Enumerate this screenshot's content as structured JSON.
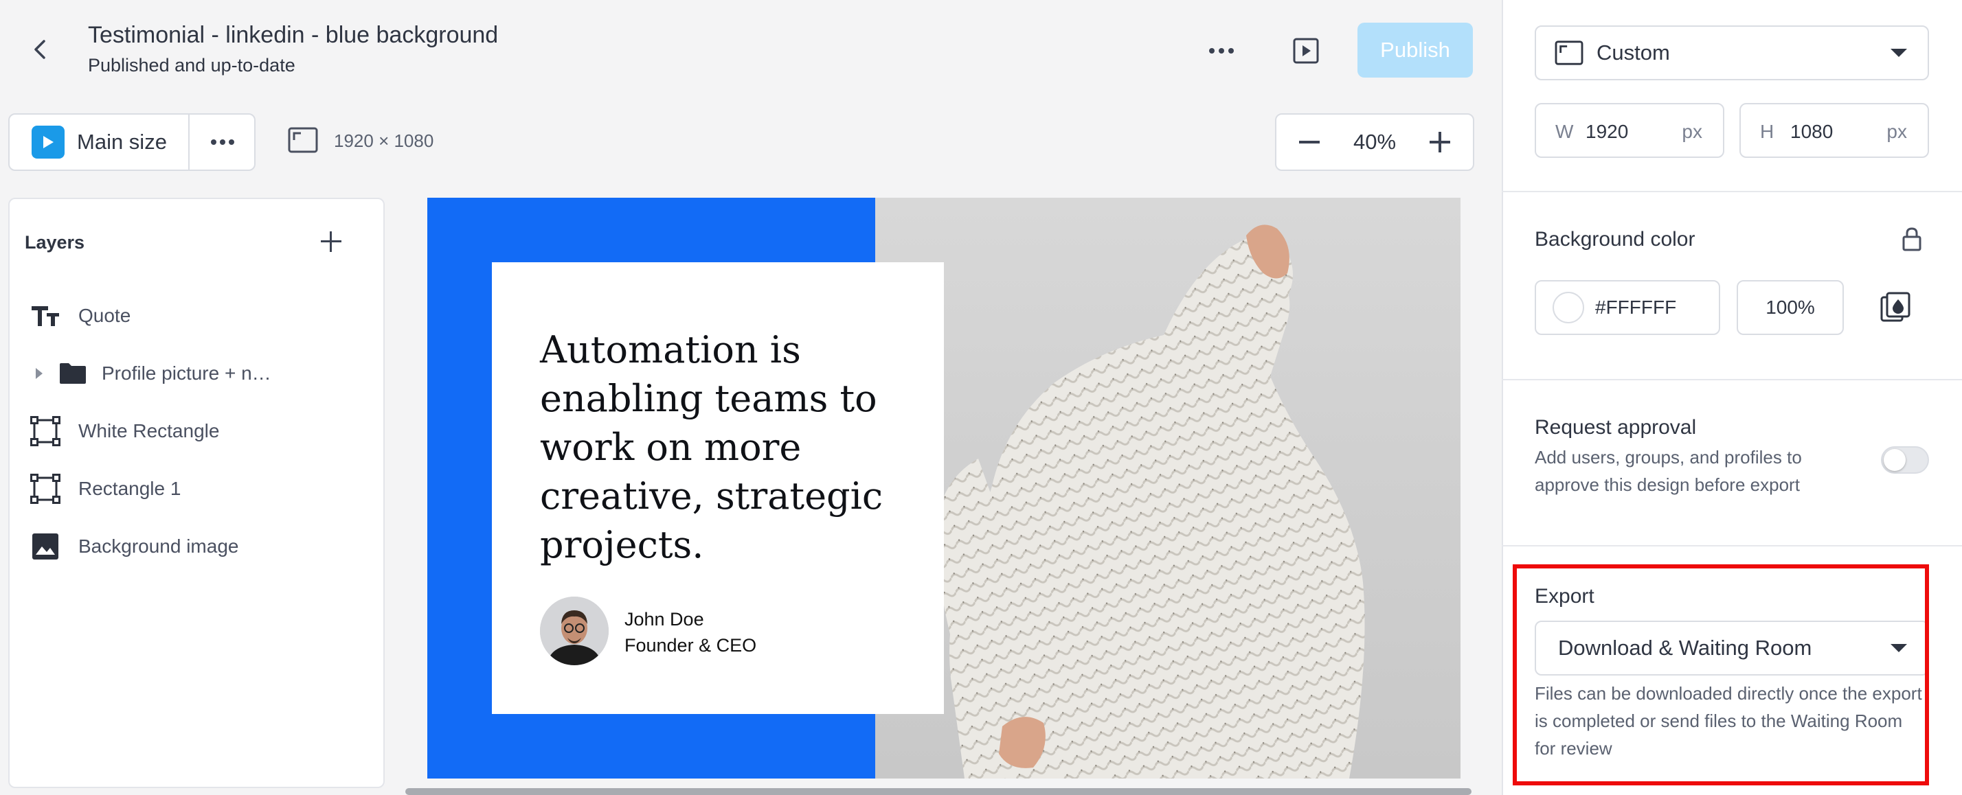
{
  "header": {
    "title": "Testimonial - linkedin - blue background",
    "status": "Published and up-to-date",
    "publish_label": "Publish"
  },
  "toolbar": {
    "size_label": "Main size",
    "dimensions": "1920 × 1080",
    "zoom": "40%"
  },
  "layers": {
    "title": "Layers",
    "items": [
      {
        "label": "Quote",
        "icon": "text-icon"
      },
      {
        "label": "Profile picture + n…",
        "icon": "folder-icon"
      },
      {
        "label": "White Rectangle",
        "icon": "frame-icon"
      },
      {
        "label": "Rectangle 1",
        "icon": "frame-icon"
      },
      {
        "label": "Background image",
        "icon": "image-icon"
      }
    ]
  },
  "canvas": {
    "quote": "Automation is enabling teams to work on more creative, strategic projects.",
    "author_name": "John Doe",
    "author_role": "Founder & CEO"
  },
  "panel": {
    "preset": "Custom",
    "width_label": "W",
    "width_value": "1920",
    "height_label": "H",
    "height_value": "1080",
    "unit": "px",
    "bg_title": "Background color",
    "bg_hex": "#FFFFFF",
    "bg_opacity": "100%",
    "approval_title": "Request approval",
    "approval_desc": "Add users, groups, and profiles to approve this design before export",
    "export_title": "Export",
    "export_value": "Download & Waiting Room",
    "export_desc": "Files can be downloaded directly once the export is completed or send files to the Waiting Room for review"
  },
  "colors": {
    "accent": "#1a9ae8",
    "canvas_blue": "#126bf6",
    "highlight": "#ee0b0b",
    "publish_disabled": "#b3e0fb"
  }
}
